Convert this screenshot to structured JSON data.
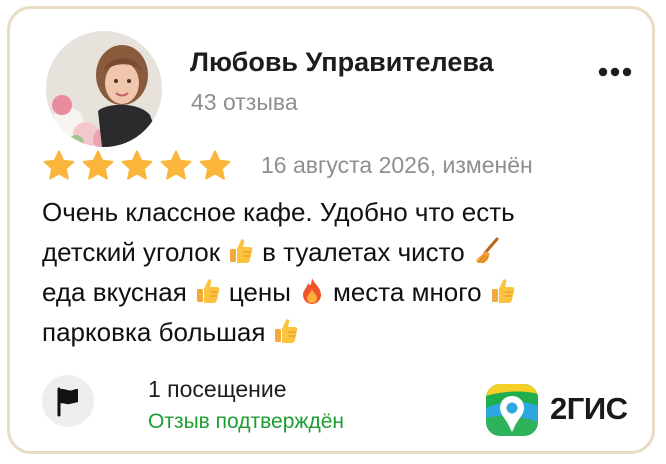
{
  "author": {
    "name": "Любовь Управителева",
    "reviews_count": "43 отзыва",
    "avatar_icon": "user-photo"
  },
  "menu_icon": "more-horizontal-icon",
  "review": {
    "rating": 5,
    "max_rating": 5,
    "date": "16 августа 2026, изменён",
    "text": "Очень классное кафе. Удобно что есть детский уголок 👍 в туалетах чисто 🧹 еда вкусная 👍 цены 🔥 места много 👍 парковка большая 👍",
    "lines": [
      {
        "parts": [
          "Очень классное кафе. Удобно что есть"
        ]
      },
      {
        "parts": [
          "детский уголок",
          "в туалетах чисто"
        ]
      },
      {
        "parts": [
          "еда вкусная",
          "цены",
          "места много"
        ]
      },
      {
        "parts": [
          "парковка большая"
        ]
      }
    ]
  },
  "footer": {
    "visits": "1 посещение",
    "verified": "Отзыв подтверждён",
    "flag_icon": "flag-icon"
  },
  "brand": {
    "name": "2ГИС",
    "logo_icon": "2gis-logo"
  },
  "colors": {
    "star": "#fbb53b",
    "verified": "#1e9d33",
    "border": "#e9dcc4",
    "secondary_text": "#8e8e93"
  }
}
